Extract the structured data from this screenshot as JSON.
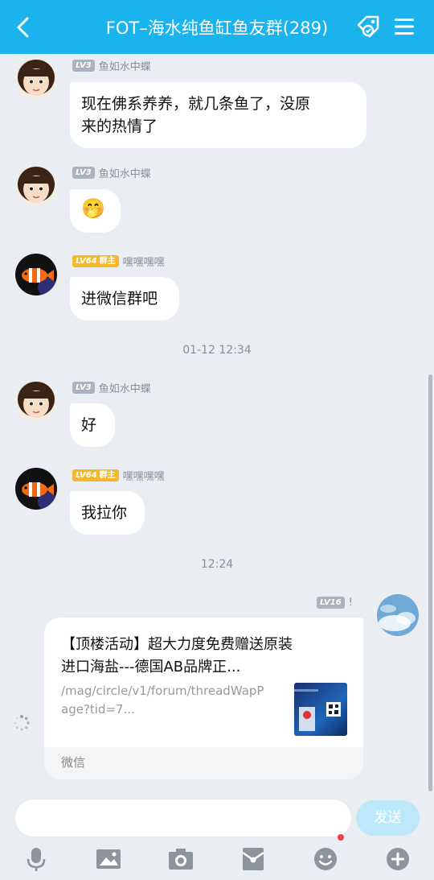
{
  "header": {
    "title": "FOT–海水纯鱼缸鱼友群(289)"
  },
  "messages": [
    {
      "level": "LV3",
      "name": "鱼如水中蝶",
      "text_line1": "现在佛系养养，就几条鱼了，没原",
      "text_line2": "来的热情了"
    },
    {
      "level": "LV3",
      "name": "鱼如水中蝶",
      "emoji": "🤭"
    },
    {
      "level": "LV64",
      "role": "群主",
      "name": "嘿嘿嘿嘿",
      "text": "进微信群吧"
    },
    {
      "timestamp": "01-12 12:34"
    },
    {
      "level": "LV3",
      "name": "鱼如水中蝶",
      "text": "好"
    },
    {
      "level": "LV64",
      "role": "群主",
      "name": "嘿嘿嘿嘿",
      "text": "我拉你"
    },
    {
      "timestamp": "12:24"
    }
  ],
  "self_message": {
    "level": "LV16",
    "name": "!",
    "card_title_line1": "【顶楼活动】超大力度免费赠送原装",
    "card_title_line2": "进口海盐---德国AB品牌正...",
    "card_url_line1": "/mag/circle/v1/forum/threadWapP",
    "card_url_line2": "age?tid=7...",
    "card_source": "微信"
  },
  "input": {
    "placeholder": "",
    "send_label": "发送"
  },
  "toolbar": [
    "microphone-icon",
    "image-icon",
    "camera-icon",
    "red-packet-icon",
    "emoji-icon",
    "plus-icon"
  ],
  "colors": {
    "header": "#1bb3ee",
    "background": "#eaeef3",
    "owner_badge": "#f5b829",
    "send_disabled": "#bde8fa"
  }
}
